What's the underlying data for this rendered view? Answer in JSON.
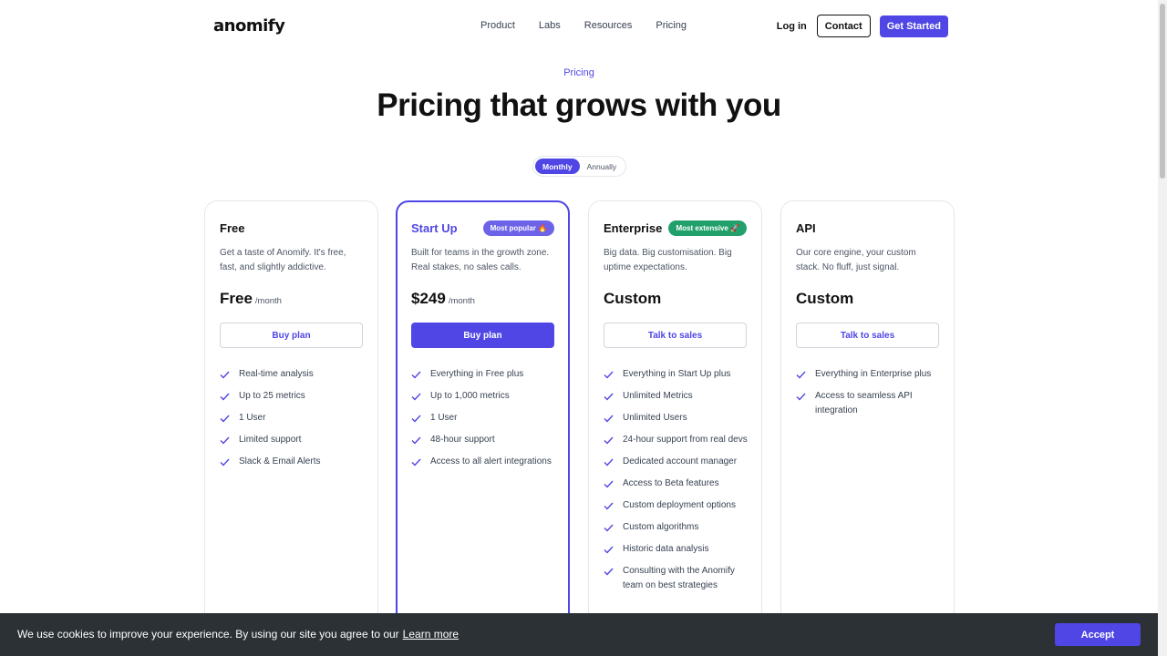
{
  "nav": {
    "logo": "anomify",
    "links": [
      "Product",
      "Labs",
      "Resources",
      "Pricing"
    ],
    "login": "Log in",
    "contact": "Contact",
    "get_started": "Get Started"
  },
  "hero": {
    "eyebrow": "Pricing",
    "title": "Pricing that grows with you"
  },
  "billing_toggle": {
    "options": [
      "Monthly",
      "Annually"
    ],
    "selected": "Monthly"
  },
  "plans": [
    {
      "name": "Free",
      "badge": "",
      "description": "Get a taste of Anomify. It's free, fast, and slightly addictive.",
      "price": "Free",
      "per": "/month",
      "cta": "Buy plan",
      "features": [
        "Real-time analysis",
        "Up to 25 metrics",
        "1 User",
        "Limited support",
        "Slack & Email Alerts"
      ]
    },
    {
      "name": "Start Up",
      "badge": "Most popular 🔥",
      "description": "Built for teams in the growth zone. Real stakes, no sales calls.",
      "price": "$249",
      "per": "/month",
      "cta": "Buy plan",
      "features": [
        "Everything in Free plus",
        "Up to 1,000 metrics",
        "1 User",
        "48-hour support",
        "Access to all alert integrations"
      ]
    },
    {
      "name": "Enterprise",
      "badge": "Most extensive 🚀",
      "description": "Big data. Big customisation. Big uptime expectations.",
      "price": "Custom",
      "per": "",
      "cta": "Talk to sales",
      "features": [
        "Everything in Start Up plus",
        "Unlimited Metrics",
        "Unlimited Users",
        "24-hour support from real devs",
        "Dedicated account manager",
        "Access to Beta features",
        "Custom deployment options",
        "Custom algorithms",
        "Historic data analysis",
        "Consulting with the Anomify team on best strategies"
      ]
    },
    {
      "name": "API",
      "badge": "",
      "description": "Our core engine, your custom stack. No fluff, just signal.",
      "price": "Custom",
      "per": "",
      "cta": "Talk to sales",
      "features": [
        "Everything in Enterprise plus",
        "Access to seamless API integration"
      ]
    }
  ],
  "cookie": {
    "text": "We use cookies to improve your experience. By using our site you agree to our",
    "link": "Learn more",
    "accept": "Accept"
  },
  "colors": {
    "accent": "#4f46e5",
    "badge_popular": "#6c63e8",
    "badge_extensive": "#22a06b",
    "cookie_bar": "#2b3135"
  }
}
